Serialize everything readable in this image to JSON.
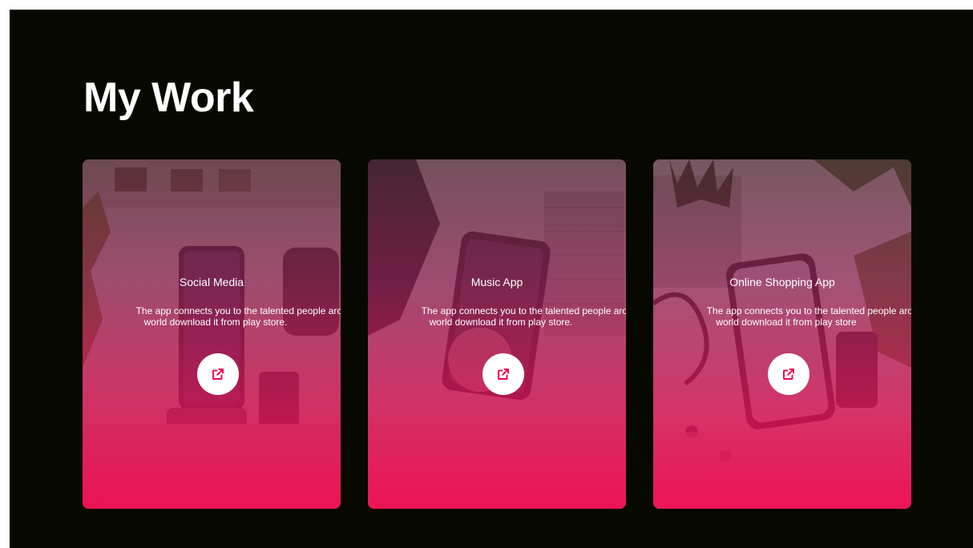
{
  "section": {
    "title": "My Work"
  },
  "projects": [
    {
      "title": "Social Media",
      "description_line1": "The app connects you to the talented people aroun",
      "description_line2": "world download it from play store.",
      "link_icon": "external-link-icon"
    },
    {
      "title": "Music App",
      "description_line1": "The app connects you to the talented people aroun",
      "description_line2": "world download it from play store.",
      "link_icon": "external-link-icon"
    },
    {
      "title": "Online Shopping App",
      "description_line1": "The app connects you to the talented people aroun",
      "description_line2": "world download it from play store",
      "link_icon": "external-link-icon"
    }
  ],
  "colors": {
    "background": "#080802",
    "accent": "#f0084f",
    "title_text": "#ffffff"
  }
}
